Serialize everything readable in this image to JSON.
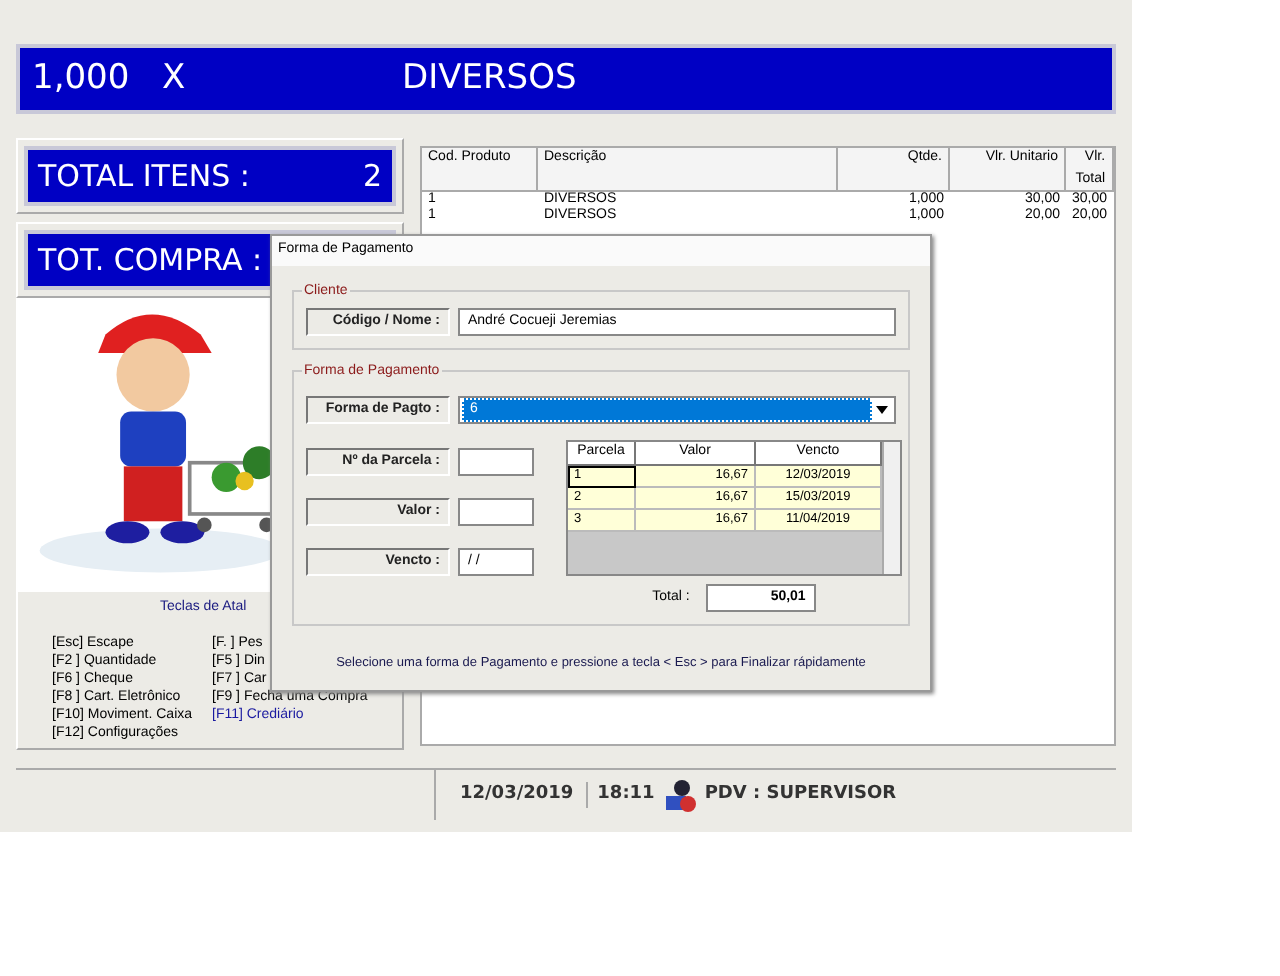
{
  "top_bar": {
    "quantity": "1,000",
    "times": "X",
    "product": "DIVERSOS"
  },
  "total_items": {
    "label": "TOTAL  ITENS :",
    "value": "2"
  },
  "total_purchase": {
    "label": "TOT. COMPRA :"
  },
  "shortcuts": {
    "title": "Teclas de Atal",
    "items": [
      {
        "text": "[Esc]  Escape",
        "color": "#000000"
      },
      {
        "text": "[F. ]  Pes",
        "color": "#000000"
      },
      {
        "text": "[F2 ]  Quantidade",
        "color": "#000000"
      },
      {
        "text": "[F5 ]  Din",
        "color": "#000000"
      },
      {
        "text": "[F6 ]  Cheque",
        "color": "#000000"
      },
      {
        "text": "[F7 ]  Car",
        "color": "#000000"
      },
      {
        "text": "[F8 ]  Cart. Eletrônico",
        "color": "#000000"
      },
      {
        "text": "[F9 ]  Fecha uma Compra",
        "color": "#000000"
      },
      {
        "text": "[F10]  Moviment. Caixa",
        "color": "#000000"
      },
      {
        "text": "[F11]  Crediário",
        "color": "#1a1aa0"
      },
      {
        "text": "[F12]  Configurações",
        "color": "#000000"
      }
    ]
  },
  "items_table": {
    "columns": [
      "Cod. Produto",
      "Descrição",
      "Qtde.",
      "Vlr. Unitario",
      "Vlr. Total"
    ],
    "rows": [
      [
        "1",
        "DIVERSOS",
        "1,000",
        "30,00",
        "30,00"
      ],
      [
        "1",
        "DIVERSOS",
        "1,000",
        "20,00",
        "20,00"
      ]
    ]
  },
  "status_bar": {
    "date": "12/03/2019",
    "time": "18:11",
    "user": "PDV :  SUPERVISOR"
  },
  "dialog": {
    "title": "Forma de Pagamento",
    "client_group": {
      "title": "Cliente",
      "label": "Código / Nome :",
      "value": "André Cocueji Jeremias"
    },
    "payment_group": {
      "title": "Forma de Pagamento",
      "method": {
        "label": "Forma de Pagto :",
        "value": "6"
      },
      "installment_number": {
        "label": "Nº da Parcela :"
      },
      "amount": {
        "label": "Valor :"
      },
      "due": {
        "label": "Vencto :",
        "value": "/ /"
      },
      "grid": {
        "columns": [
          "Parcela",
          "Valor",
          "Vencto"
        ],
        "rows": [
          {
            "cells": [
              "1",
              "16,67",
              "12/03/2019"
            ],
            "selected": true
          },
          {
            "cells": [
              "2",
              "16,67",
              "15/03/2019"
            ],
            "selected": false
          },
          {
            "cells": [
              "3",
              "16,67",
              "11/04/2019"
            ],
            "selected": false
          }
        ]
      },
      "total": {
        "label": "Total :",
        "value": "50,01"
      }
    },
    "hint": "Selecione uma forma de Pagamento e pressione a tecla < Esc > para Finalizar rápidamente"
  }
}
